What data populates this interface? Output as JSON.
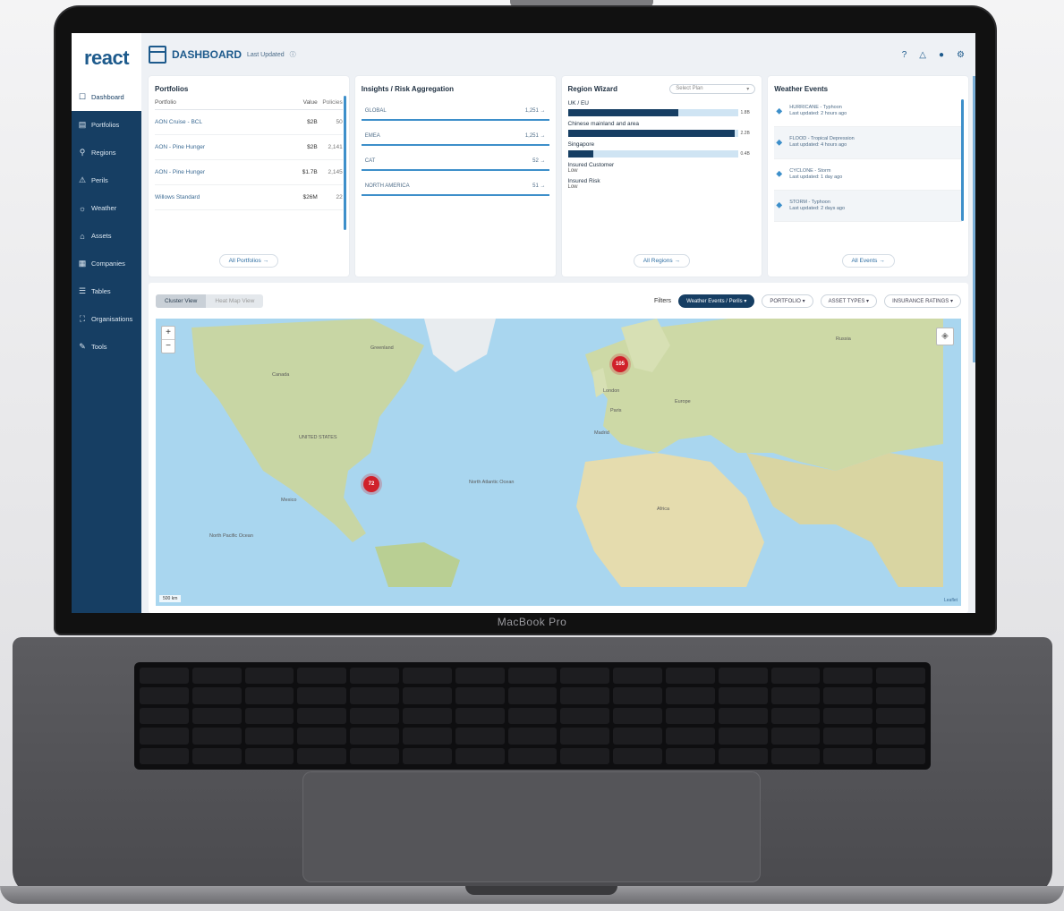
{
  "device": {
    "label": "MacBook Pro"
  },
  "app": {
    "logo": "react"
  },
  "header": {
    "title": "DASHBOARD",
    "subtitle": "Last Updated"
  },
  "sidebar": {
    "items": [
      {
        "label": "Dashboard",
        "icon": "dashboard-icon",
        "glyph": "☐"
      },
      {
        "label": "Portfolios",
        "icon": "portfolio-icon",
        "glyph": "▤"
      },
      {
        "label": "Regions",
        "icon": "region-icon",
        "glyph": "⚲"
      },
      {
        "label": "Perils",
        "icon": "peril-icon",
        "glyph": "⚠"
      },
      {
        "label": "Weather",
        "icon": "weather-icon",
        "glyph": "☼"
      },
      {
        "label": "Assets",
        "icon": "assets-icon",
        "glyph": "⌂"
      },
      {
        "label": "Companies",
        "icon": "companies-icon",
        "glyph": "▦"
      },
      {
        "label": "Tables",
        "icon": "tables-icon",
        "glyph": "☰"
      },
      {
        "label": "Organisations",
        "icon": "organisation-icon",
        "glyph": "⛶"
      },
      {
        "label": "Tools",
        "icon": "tools-icon",
        "glyph": "✎"
      }
    ]
  },
  "portfolios": {
    "title": "Portfolios",
    "headers": [
      "Portfolio",
      "Value",
      "Policies"
    ],
    "rows": [
      {
        "name": "AON Cruise - BCL",
        "value": "$2B",
        "policies": "50"
      },
      {
        "name": "AON - Pine Hunger",
        "value": "$2B",
        "policies": "2,141"
      },
      {
        "name": "AON - Pine Hunger",
        "value": "$1.7B",
        "policies": "2,145"
      },
      {
        "name": "Willows Standard",
        "value": "$26M",
        "policies": "22"
      }
    ],
    "view_all": "All Portfolios"
  },
  "insights": {
    "title": "Insights / Risk Aggregation",
    "rows": [
      {
        "name": "GLOBAL",
        "value": "1,251"
      },
      {
        "name": "EMEA",
        "value": "1,251"
      },
      {
        "name": "CAT",
        "value": "52"
      },
      {
        "name": "NORTH AMERICA",
        "value": "51"
      }
    ]
  },
  "regions": {
    "title": "Region Wizard",
    "select_placeholder": "Select Plan",
    "items": [
      {
        "label": "UK / EU",
        "pct": 0.65,
        "num": "1.8B"
      },
      {
        "label": "Chinese mainland and area",
        "pct": 0.98,
        "num": "2.2B"
      },
      {
        "label": "Singapore",
        "pct": 0.15,
        "num": "0.4B"
      }
    ],
    "extra": [
      {
        "label": "Insured Customer",
        "sub": "Low"
      },
      {
        "label": "Insured Risk",
        "sub": "Low"
      }
    ],
    "view_all": "All Regions"
  },
  "weather": {
    "title": "Weather Events",
    "events": [
      {
        "name": "HURRICANE - Typhoon",
        "detail": "Last updated: 2 hours ago"
      },
      {
        "name": "FLOOD - Tropical Depression",
        "detail": "Last updated: 4 hours ago"
      },
      {
        "name": "CYCLONE - Storm",
        "detail": "Last updated: 1 day ago"
      },
      {
        "name": "STORM - Typhoon",
        "detail": "Last updated: 2 days ago"
      }
    ],
    "view_all": "All Events"
  },
  "map_panel": {
    "toggle": [
      "Cluster View",
      "Heat Map View"
    ],
    "filters_label": "Filters",
    "chips": [
      "Weather Events / Perils",
      "PORTFOLIO",
      "ASSET TYPES",
      "INSURANCE RATINGS"
    ],
    "markers": [
      {
        "label": "105",
        "region": "Europe"
      },
      {
        "label": "72",
        "region": "Gulf of Mexico"
      }
    ],
    "labels": [
      "Greenland",
      "UNITED STATES",
      "Mexico",
      "North Atlantic Ocean",
      "North Pacific Ocean",
      "Europe",
      "Africa",
      "Russia",
      "London",
      "Paris",
      "Madrid",
      "Canada"
    ],
    "scale": "500 km",
    "attribution": "Leaflet"
  }
}
